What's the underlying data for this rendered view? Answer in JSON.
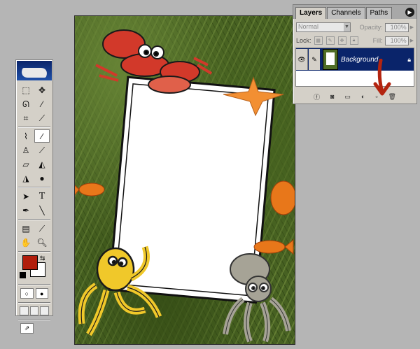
{
  "layers_panel": {
    "tabs": [
      "Layers",
      "Channels",
      "Paths"
    ],
    "active_tab": "Layers",
    "blend_mode": "Normal",
    "opacity_label": "Opacity:",
    "opacity_value": "100%",
    "lock_label": "Lock:",
    "fill_label": "Fill:",
    "fill_value": "100%",
    "layer_name": "Background"
  },
  "colors": {
    "foreground": "#b11d0b",
    "background": "#ffffff",
    "selection": "#0a246a",
    "arrow_annotation": "#b3240f"
  },
  "toolbox": {
    "tools": [
      "marquee-tool",
      "move-tool",
      "lasso-tool",
      "magic-wand-tool",
      "crop-tool",
      "slice-tool",
      "healing-brush-tool",
      "brush-tool",
      "clone-stamp-tool",
      "history-brush-tool",
      "eraser-tool",
      "paint-bucket-tool",
      "blur-tool",
      "dodge-tool",
      "path-selection-tool",
      "type-tool",
      "pen-tool",
      "line-tool",
      "notes-tool",
      "eyedropper-tool",
      "hand-tool",
      "zoom-tool"
    ],
    "type_glyph": "T"
  }
}
